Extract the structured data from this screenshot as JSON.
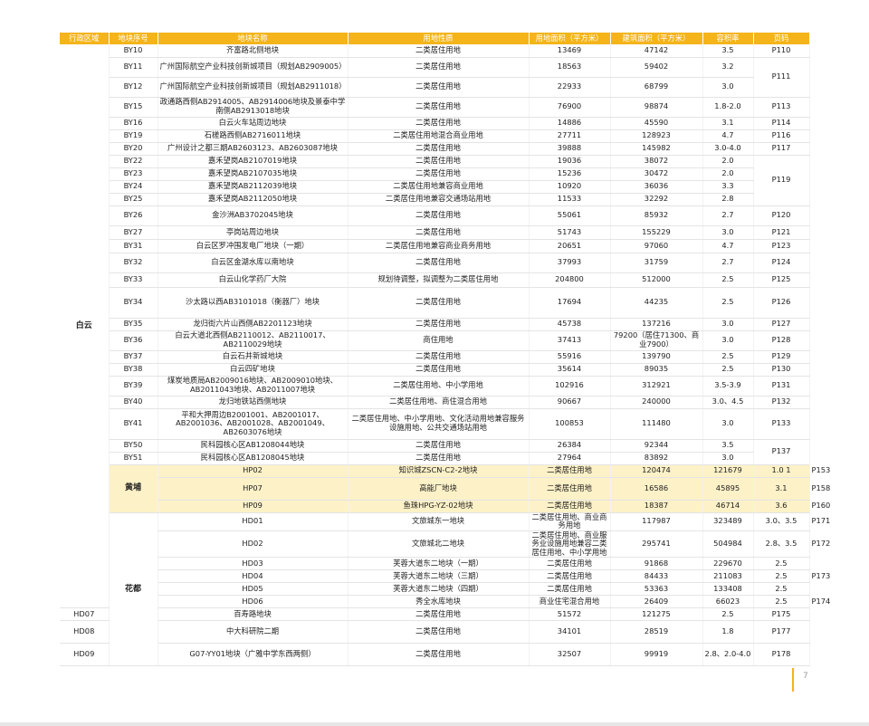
{
  "headers": [
    "行政区域",
    "地块序号",
    "地块名称",
    "用地性质",
    "用地面积（平方米）",
    "建筑面积（平方米）",
    "容积率",
    "页码"
  ],
  "colors": {
    "accent": "#f4b41a",
    "highlight": "#fdf1c7"
  },
  "page_number": "7",
  "rows": [
    {
      "district": "白云",
      "districtSpan": 35,
      "code": "BY10",
      "name": "齐富路北侧地块",
      "use": "二类居住用地",
      "area": "13469",
      "floor": "47142",
      "ratio": "3.5",
      "page": "P110",
      "pageSpan": 1,
      "h": 14
    },
    {
      "code": "BY11",
      "name": "广州国际航空产业科技创新城项目（规划AB2909005）",
      "use": "二类居住用地",
      "area": "18563",
      "floor": "59402",
      "ratio": "3.2",
      "page": "P111",
      "pageSpan": 2,
      "h": 22
    },
    {
      "code": "BY12",
      "name": "广州国际航空产业科技创新城项目（规划AB2911018）",
      "use": "二类居住用地",
      "area": "22933",
      "floor": "68799",
      "ratio": "3.0",
      "h": 22
    },
    {
      "code": "BY15",
      "name": "政通路西侧AB2914005、AB2914006地块及景泰中学南侧AB2913018地块",
      "use": "二类居住用地",
      "area": "76900",
      "floor": "98874",
      "ratio": "1.8-2.0",
      "page": "P113",
      "pageSpan": 1,
      "h": 22
    },
    {
      "code": "BY16",
      "name": "白云火车站周边地块",
      "use": "二类居住用地",
      "area": "14886",
      "floor": "45590",
      "ratio": "3.1",
      "page": "P114",
      "pageSpan": 1,
      "h": 14
    },
    {
      "code": "BY19",
      "name": "石槎路西侧AB2716011地块",
      "use": "二类居住用地混合商业用地",
      "area": "27711",
      "floor": "128923",
      "ratio": "4.7",
      "page": "P116",
      "pageSpan": 1,
      "h": 14
    },
    {
      "code": "BY20",
      "name": "广州设计之都三期AB2603123、AB2603087地块",
      "use": "二类居住用地",
      "area": "39888",
      "floor": "145982",
      "ratio": "3.0-4.0",
      "page": "P117",
      "pageSpan": 1,
      "h": 14
    },
    {
      "code": "BY22",
      "name": "嘉禾望岗AB2107019地块",
      "use": "二类居住用地",
      "area": "19036",
      "floor": "38072",
      "ratio": "2.0",
      "page": "P119",
      "pageSpan": 4,
      "h": 14
    },
    {
      "code": "BY23",
      "name": "嘉禾望岗AB2107035地块",
      "use": "二类居住用地",
      "area": "15236",
      "floor": "30472",
      "ratio": "2.0",
      "h": 14
    },
    {
      "code": "BY24",
      "name": "嘉禾望岗AB2112039地块",
      "use": "二类居住用地兼容商业用地",
      "area": "10920",
      "floor": "36036",
      "ratio": "3.3",
      "h": 14
    },
    {
      "code": "BY25",
      "name": "嘉禾望岗AB2112050地块",
      "use": "二类居住用地兼容交通场站用地",
      "area": "11533",
      "floor": "32292",
      "ratio": "2.8",
      "h": 14
    },
    {
      "code": "BY26",
      "name": "金沙洲AB3702045地块",
      "use": "二类居住用地",
      "area": "55061",
      "floor": "85932",
      "ratio": "2.7",
      "page": "P120",
      "pageSpan": 1,
      "h": 22
    },
    {
      "code": "BY27",
      "name": "亭岗站周边地块",
      "use": "二类居住用地",
      "area": "51743",
      "floor": "155229",
      "ratio": "3.0",
      "page": "P121",
      "pageSpan": 1,
      "h": 15
    },
    {
      "code": "BY31",
      "name": "白云区罗冲围发电厂地块（一期）",
      "use": "二类居住用地兼容商业商务用地",
      "area": "20651",
      "floor": "97060",
      "ratio": "4.7",
      "page": "P123",
      "pageSpan": 1,
      "h": 15
    },
    {
      "code": "BY32",
      "name": "白云区金湖水库以南地块",
      "use": "二类居住用地",
      "area": "37993",
      "floor": "31759",
      "ratio": "2.7",
      "page": "P124",
      "pageSpan": 1,
      "h": 22
    },
    {
      "code": "BY33",
      "name": "白云山化学药厂大院",
      "use": "规划待调整，拟调整为二类居住用地",
      "area": "204800",
      "floor": "512000",
      "ratio": "2.5",
      "page": "P125",
      "pageSpan": 1,
      "h": 16
    },
    {
      "code": "BY34",
      "name": "沙太路以西AB3101018（衡器厂）地块",
      "use": "二类居住用地",
      "area": "17694",
      "floor": "44235",
      "ratio": "2.5",
      "page": "P126",
      "pageSpan": 1,
      "h": 34
    },
    {
      "code": "BY35",
      "name": "龙归街六片山西侧AB2201123地块",
      "use": "二类居住用地",
      "area": "45738",
      "floor": "137216",
      "ratio": "3.0",
      "page": "P127",
      "pageSpan": 1,
      "h": 14
    },
    {
      "code": "BY36",
      "name": "白云大道北西侧AB2110012、AB2110017、AB2110029地块",
      "use": "商住用地",
      "area": "37413",
      "floor": "79200（居住71300、商业7900）",
      "ratio": "3.0",
      "page": "P128",
      "pageSpan": 1,
      "h": 22
    },
    {
      "code": "BY37",
      "name": "白云石井新城地块",
      "use": "二类居住用地",
      "area": "55916",
      "floor": "139790",
      "ratio": "2.5",
      "page": "P129",
      "pageSpan": 1,
      "h": 14
    },
    {
      "code": "BY38",
      "name": "白云四矿地块",
      "use": "二类居住用地",
      "area": "35614",
      "floor": "89035",
      "ratio": "2.5",
      "page": "P130",
      "pageSpan": 1,
      "h": 14
    },
    {
      "code": "BY39",
      "name": "煤炭地质局AB2009016地块、AB2009010地块、AB2011043地块、AB2011007地块",
      "use": "二类居住用地、中小学用地",
      "area": "102916",
      "floor": "312921",
      "ratio": "3.5-3.9",
      "page": "P131",
      "pageSpan": 1,
      "h": 22
    },
    {
      "code": "BY40",
      "name": "龙归地铁站西侧地块",
      "use": "二类居住用地、商住混合用地",
      "area": "90667",
      "floor": "240000",
      "ratio": "3.0、4.5",
      "page": "P132",
      "pageSpan": 1,
      "h": 14
    },
    {
      "code": "BY41",
      "name": "平和大押周边B2001001、AB2001017、AB2001036、AB2001028、AB2001049、AB2603076地块",
      "use": "二类居住用地、中小学用地、文化活动用地兼容服务设施用地、公共交通场站用地",
      "area": "100853",
      "floor": "111480",
      "ratio": "3.0",
      "page": "P133",
      "pageSpan": 1,
      "h": 34
    },
    {
      "code": "BY50",
      "name": "民科园核心区AB1208044地块",
      "use": "二类居住用地",
      "area": "26384",
      "floor": "92344",
      "ratio": "3.5",
      "page": "P137",
      "pageSpan": 2,
      "h": 14
    },
    {
      "code": "BY51",
      "name": "民科园核心区AB1208045地块",
      "use": "二类居住用地",
      "area": "27964",
      "floor": "83892",
      "ratio": "3.0",
      "h": 14
    },
    {
      "district": "黄埔",
      "districtSpan": 3,
      "hl": true,
      "code": "HP02",
      "name": "知识城ZSCN-C2-2地块",
      "use": "二类居住用地",
      "area": "120474",
      "floor": "121679",
      "ratio": "1.0 1",
      "page": "P153",
      "pageSpan": 1,
      "h": 14
    },
    {
      "hl": true,
      "code": "HP07",
      "name": "高能厂地块",
      "use": "二类居住用地",
      "area": "16586",
      "floor": "45895",
      "ratio": "3.1",
      "page": "P158",
      "pageSpan": 1,
      "h": 25
    },
    {
      "hl": true,
      "code": "HP09",
      "name": "鱼珠HPG-YZ-02地块",
      "use": "二类居住用地",
      "area": "18387",
      "floor": "46714",
      "ratio": "3.6",
      "page": "P160",
      "pageSpan": 1,
      "h": 14
    },
    {
      "district": "花都",
      "districtSpan": 10,
      "code": "HD01",
      "name": "文旅城东一地块",
      "use": "二类居住用地、商业商务用地",
      "area": "117987",
      "floor": "323489",
      "ratio": "3.0、3.5",
      "page": "P171",
      "pageSpan": 1,
      "h": 14
    },
    {
      "code": "HD02",
      "name": "文旅城北二地块",
      "use": "二类居住用地、商业服务业设施用地兼容二类居住用地、中小学用地",
      "area": "295741",
      "floor": "504984",
      "ratio": "2.8、3.5",
      "page": "P172",
      "pageSpan": 1,
      "h": 22
    },
    {
      "code": "HD03",
      "name": "芙蓉大道东二地块（一期）",
      "use": "二类居住用地",
      "area": "91868",
      "floor": "229670",
      "ratio": "2.5",
      "page": "P173",
      "pageSpan": 3,
      "h": 14
    },
    {
      "code": "HD04",
      "name": "芙蓉大道东二地块（三期）",
      "use": "二类居住用地",
      "area": "84433",
      "floor": "211083",
      "ratio": "2.5",
      "h": 14
    },
    {
      "code": "HD05",
      "name": "芙蓉大道东二地块（四期）",
      "use": "二类居住用地",
      "area": "53363",
      "floor": "133408",
      "ratio": "2.5",
      "h": 14
    },
    {
      "code": "HD06",
      "name": "秀全水库地块",
      "use": "商业住宅混合用地",
      "area": "26409",
      "floor": "66023",
      "ratio": "2.5",
      "page": "P174",
      "pageSpan": 1,
      "h": 14
    },
    {
      "code": "HD07",
      "name": "百寿路地块",
      "use": "二类居住用地",
      "area": "51572",
      "floor": "121275",
      "ratio": "2.5",
      "page": "P175",
      "pageSpan": 1,
      "h": 14
    },
    {
      "code": "HD08",
      "name": "中大科研院二期",
      "use": "二类居住用地",
      "area": "34101",
      "floor": "28519",
      "ratio": "1.8",
      "page": "P177",
      "pageSpan": 1,
      "h": 25
    },
    {
      "code": "HD09",
      "name": "G07-YY01地块（广雅中学东西两侧）",
      "use": "二类居住用地",
      "area": "32507",
      "floor": "99919",
      "ratio": "2.8、2.0-4.0",
      "page": "P178",
      "pageSpan": 1,
      "h": 25
    }
  ]
}
